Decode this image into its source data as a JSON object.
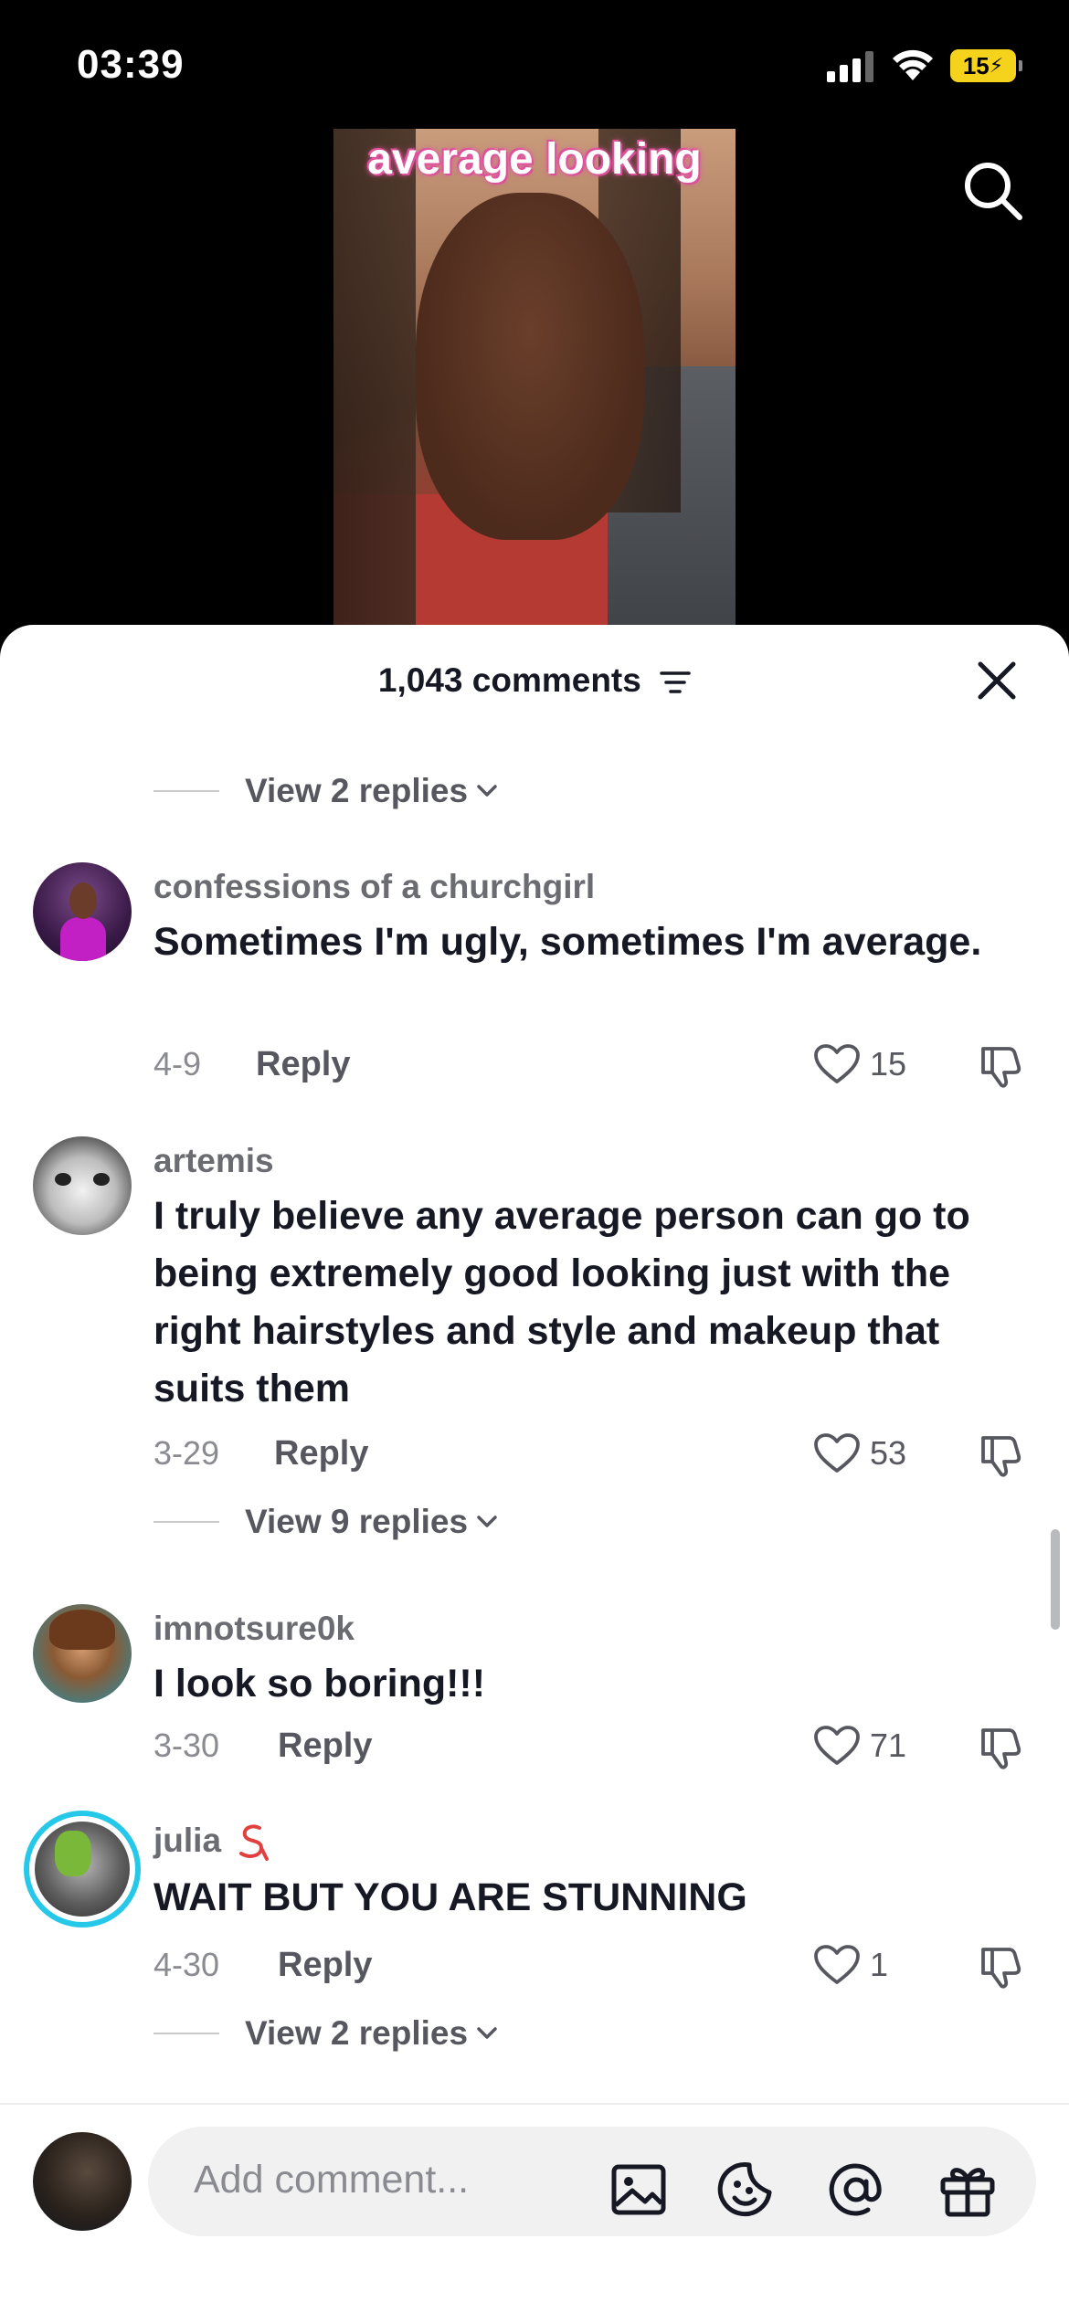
{
  "status_bar": {
    "time": "03:39",
    "battery": "15"
  },
  "video": {
    "caption": "average looking"
  },
  "comments_header": {
    "count_label": "1,043 comments"
  },
  "top_partial": {
    "view_replies": "View 2 replies"
  },
  "comments": [
    {
      "username": "confessions of a churchgirl",
      "text": "Sometimes I'm ugly, sometimes I'm average.",
      "date": "4-9",
      "reply_label": "Reply",
      "likes": "15"
    },
    {
      "username": "artemis",
      "text": "I truly believe any average person can go to being extremely good looking just with the right hairstyles and style and makeup that suits them",
      "date": "3-29",
      "reply_label": "Reply",
      "likes": "53",
      "view_replies": "View 9 replies"
    },
    {
      "username": "imnotsure0k",
      "text": "I look so boring!!!",
      "date": "3-30",
      "reply_label": "Reply",
      "likes": "71"
    },
    {
      "username": "julia",
      "text": "WAIT BUT YOU ARE STUNNING",
      "date": "4-30",
      "reply_label": "Reply",
      "likes": "1",
      "view_replies": "View 2 replies"
    }
  ],
  "composer": {
    "placeholder": "Add comment..."
  },
  "icons": {
    "search": "search-icon",
    "filter": "filter-icon",
    "close": "close-icon",
    "heart": "heart-icon",
    "dislike": "thumbs-down-icon",
    "image": "image-icon",
    "emoji": "emoji-icon",
    "mention": "at-icon",
    "gift": "gift-icon"
  },
  "colors": {
    "accent_story_ring": "#25c8e8",
    "text_primary": "#161823",
    "text_secondary": "#8a8b91"
  }
}
